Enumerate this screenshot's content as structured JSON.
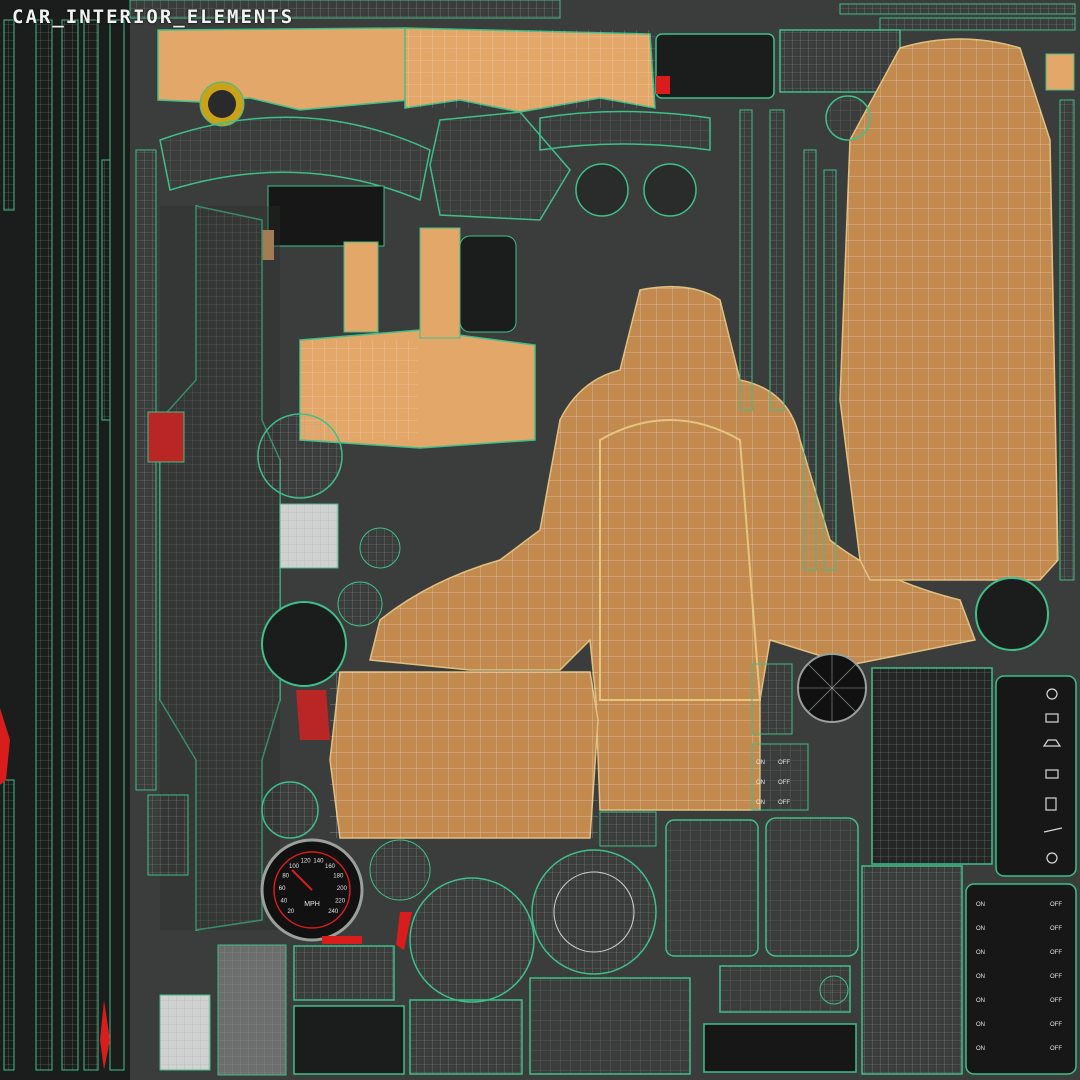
{
  "title": "CAR_INTERIOR_ELEMENTS",
  "switch_labels": {
    "on": "ON",
    "off": "OFF"
  },
  "speedometer": {
    "unit_label": "MPH",
    "scale_labels": [
      "20",
      "40",
      "60",
      "80",
      "100",
      "120",
      "140",
      "160",
      "180",
      "200",
      "220",
      "240"
    ]
  },
  "colors": {
    "background": "#2b2e2c",
    "uv_wire": "#3fbf8a",
    "leather": "#e3a76a",
    "seat_fabric": "#c28a4f",
    "dark_plastic": "#1b1d1c",
    "accent_red": "#d91c1c"
  }
}
